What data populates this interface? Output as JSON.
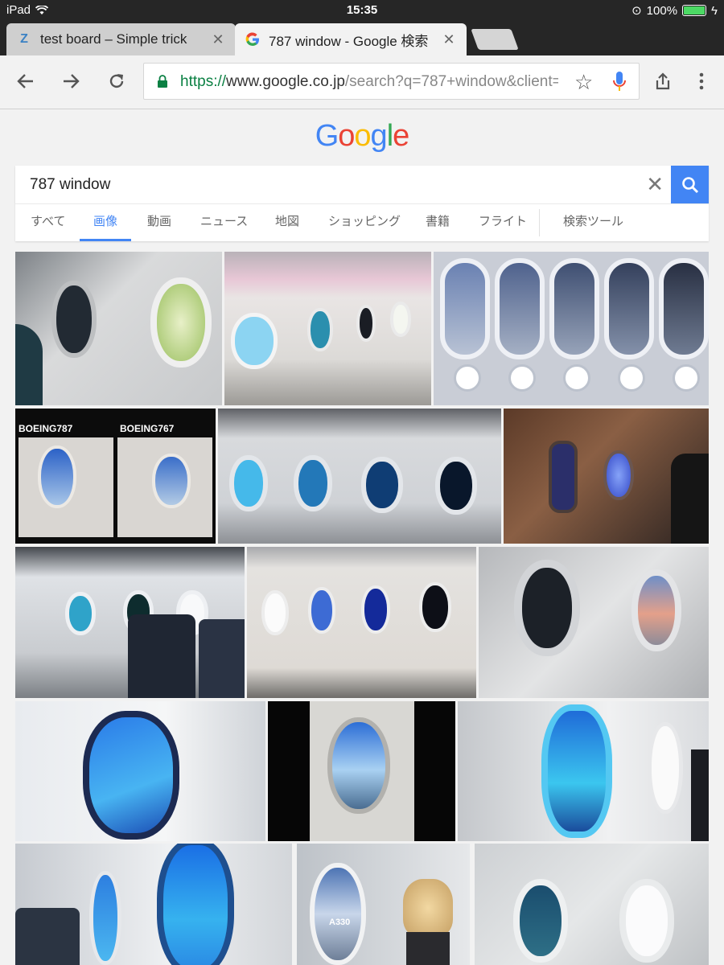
{
  "status": {
    "device": "iPad",
    "time": "15:35",
    "battery": "100%"
  },
  "tabs": [
    {
      "title": "test board – Simple trick",
      "favicon": "zenhub-icon",
      "active": false
    },
    {
      "title": "787 window - Google 検索",
      "favicon": "google-g-icon",
      "active": true
    }
  ],
  "toolbar": {
    "url_scheme": "https://",
    "url_host": "www.google.co.jp",
    "url_path": "/search?q=787+window&client=s"
  },
  "google": {
    "logo_letters": [
      "G",
      "o",
      "o",
      "g",
      "l",
      "e"
    ],
    "logo_colors": [
      "#4285f4",
      "#ea4335",
      "#fbbc05",
      "#4285f4",
      "#34a853",
      "#ea4335"
    ],
    "query": "787 window",
    "search_tabs": [
      "すべて",
      "画像",
      "動画",
      "ニュース",
      "地図",
      "ショッピング",
      "書籍",
      "フライト",
      "検索ツール"
    ],
    "active_tab": "画像"
  },
  "colors": {
    "accent": "#4285f4",
    "secure": "#0b8043"
  },
  "image_captions": {
    "boeing787": "BOEING787",
    "boeing767": "BOEING767",
    "a330": "A330"
  }
}
